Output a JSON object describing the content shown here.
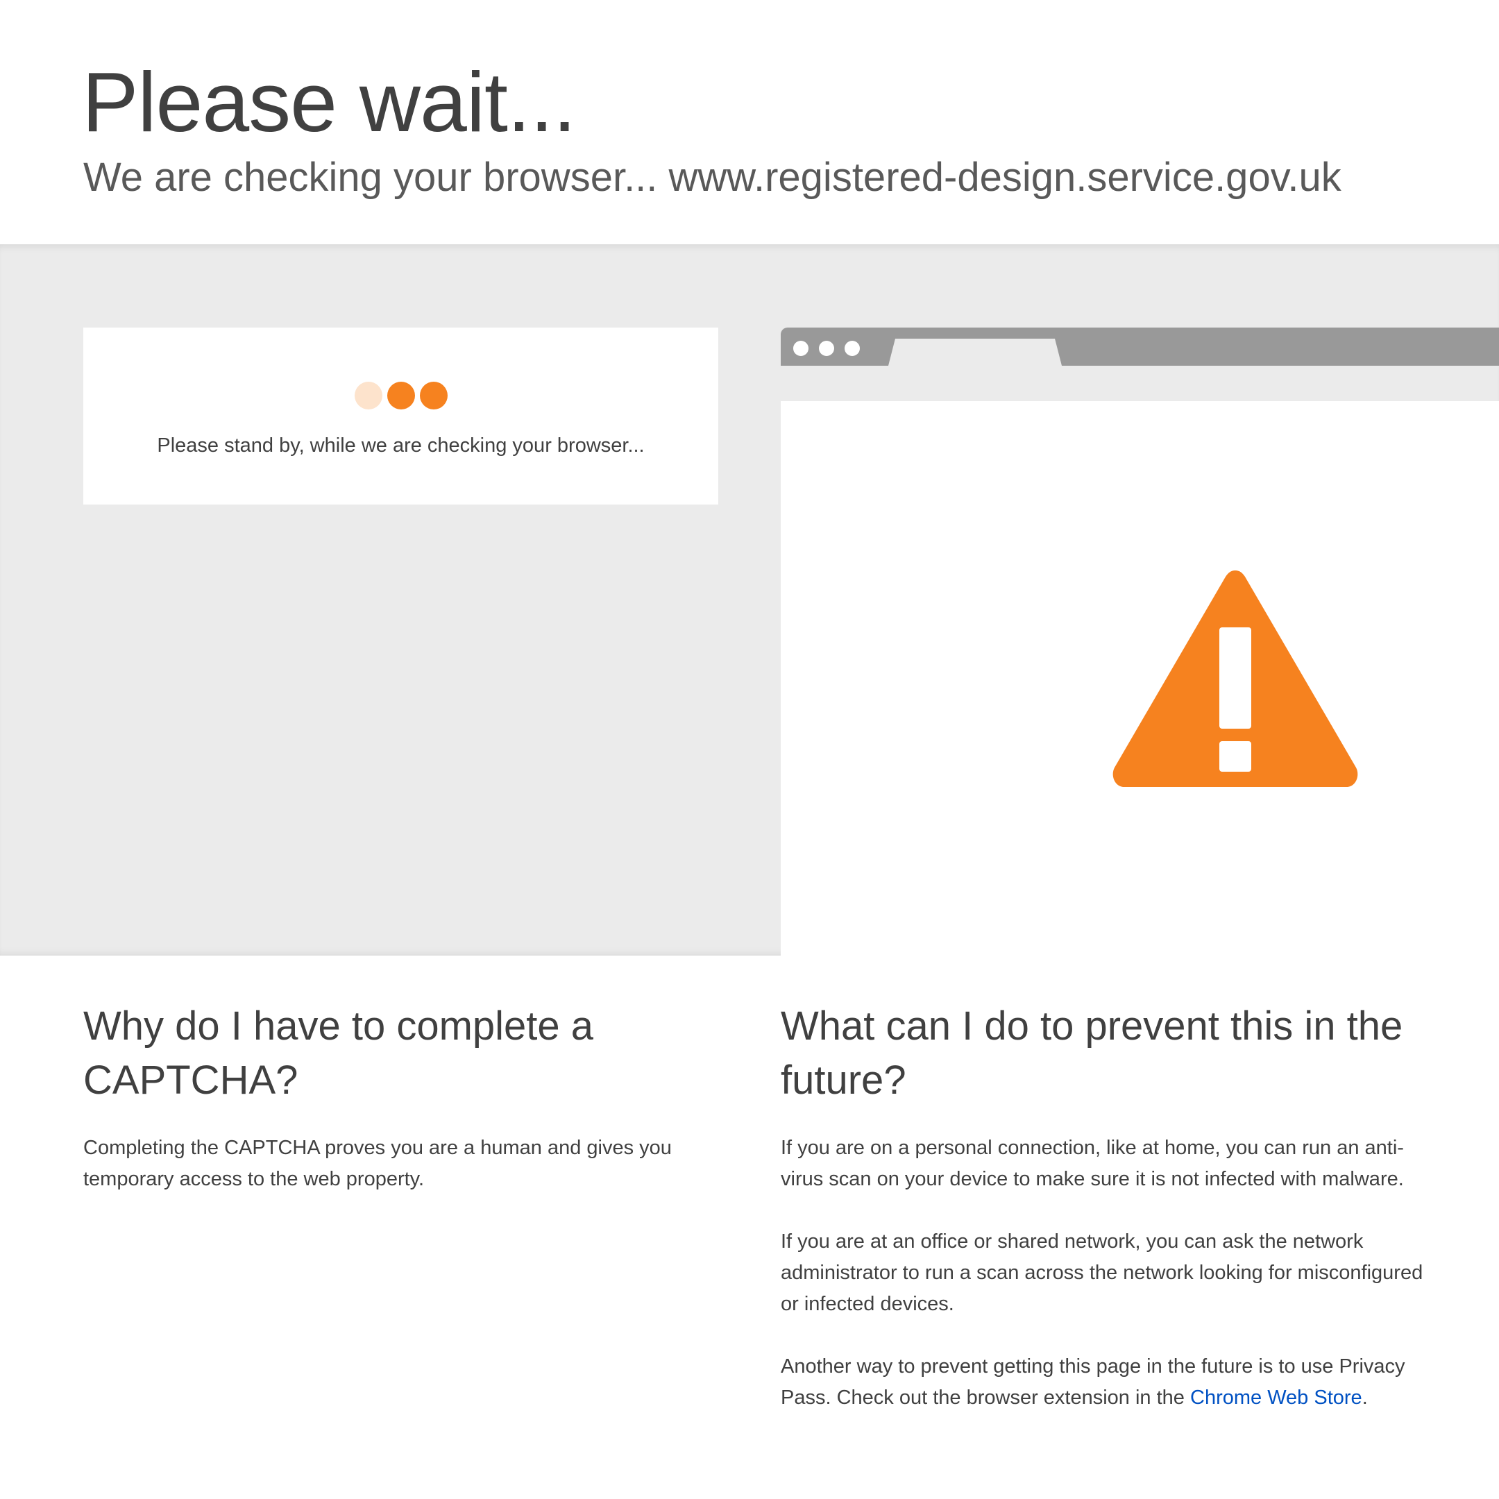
{
  "header": {
    "title": "Please wait...",
    "subtitle_prefix": "We are checking your browser...",
    "domain": "www.registered-design.service.gov.uk"
  },
  "standby": {
    "message": "Please stand by, while we are checking your browser..."
  },
  "illustration": {
    "icon": "warning-triangle-icon",
    "accent_color": "#f6821f"
  },
  "why": {
    "heading": "Why do I have to complete a CAPTCHA?",
    "body": "Completing the CAPTCHA proves you are a human and gives you temporary access to the web property."
  },
  "prevent": {
    "heading": "What can I do to prevent this in the future?",
    "paragraph_1": "If you are on a personal connection, like at home, you can run an anti-virus scan on your device to make sure it is not infected with malware.",
    "paragraph_2": "If you are at an office or shared network, you can ask the network administrator to run a scan across the network looking for misconfigured or infected devices.",
    "paragraph_3_prefix": "Another way to prevent getting this page in the future is to use Privacy Pass. Check out the browser extension in the",
    "paragraph_3_link": "Chrome Web Store",
    "paragraph_3_suffix": "."
  },
  "colors": {
    "text": "#404040",
    "band": "#ebebeb",
    "link": "#0051c3",
    "warning": "#f6821f"
  }
}
